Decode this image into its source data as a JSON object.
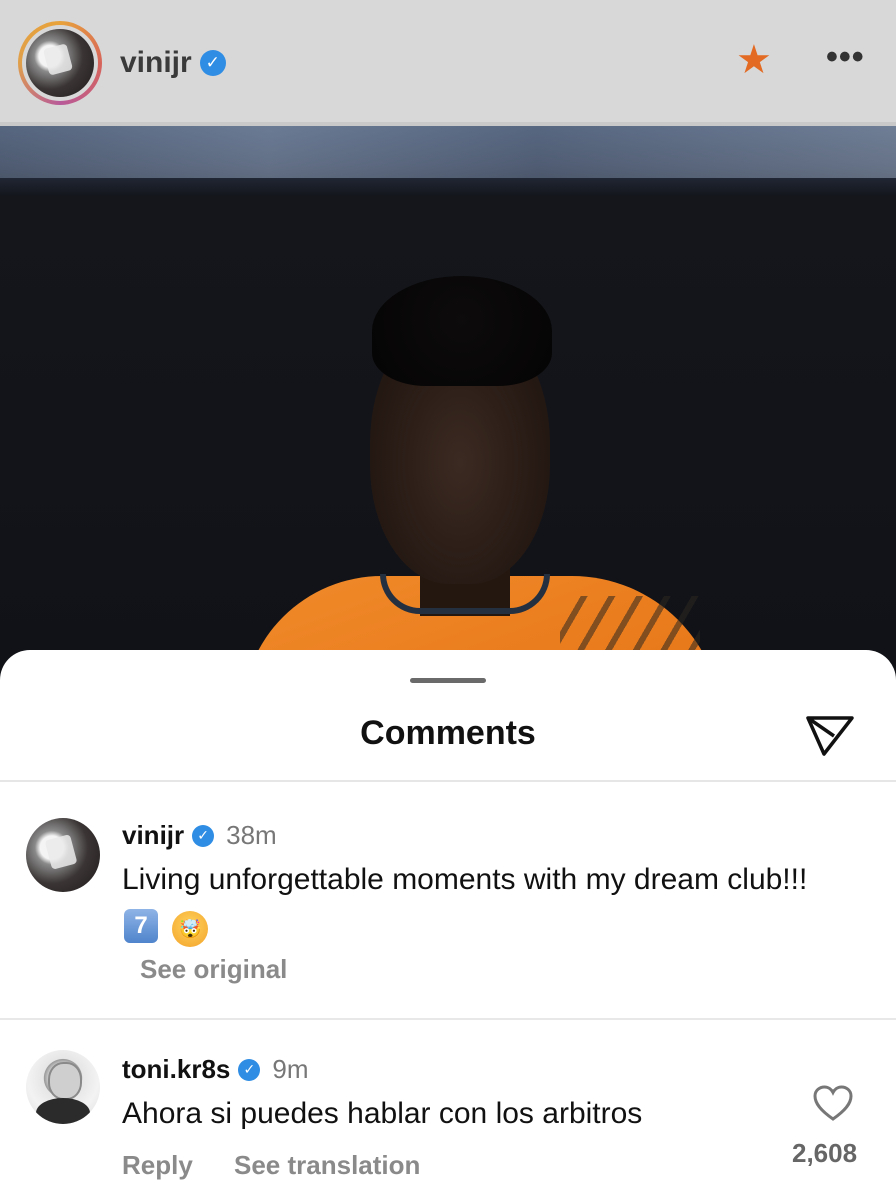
{
  "post": {
    "username": "vinijr",
    "verified_icon": "verified-badge-icon",
    "favorite_icon": "star-icon",
    "more_icon": "more-options-icon",
    "colors": {
      "accent_star": "#e26a22",
      "verified": "#2f8de4"
    }
  },
  "sheet": {
    "title": "Comments",
    "share_icon": "send-icon"
  },
  "comments": [
    {
      "username": "vinijr",
      "time": "38m",
      "text": "Living unforgettable moments with my dream club!!!",
      "emoji_seven": "7",
      "emoji_face": "🤯",
      "see_original_label": "See original"
    },
    {
      "username": "toni.kr8s",
      "time": "9m",
      "text": "Ahora si puedes hablar con los arbitros",
      "reply_label": "Reply",
      "translate_label": "See translation",
      "like_count": "2,608",
      "like_icon": "heart-icon"
    }
  ]
}
